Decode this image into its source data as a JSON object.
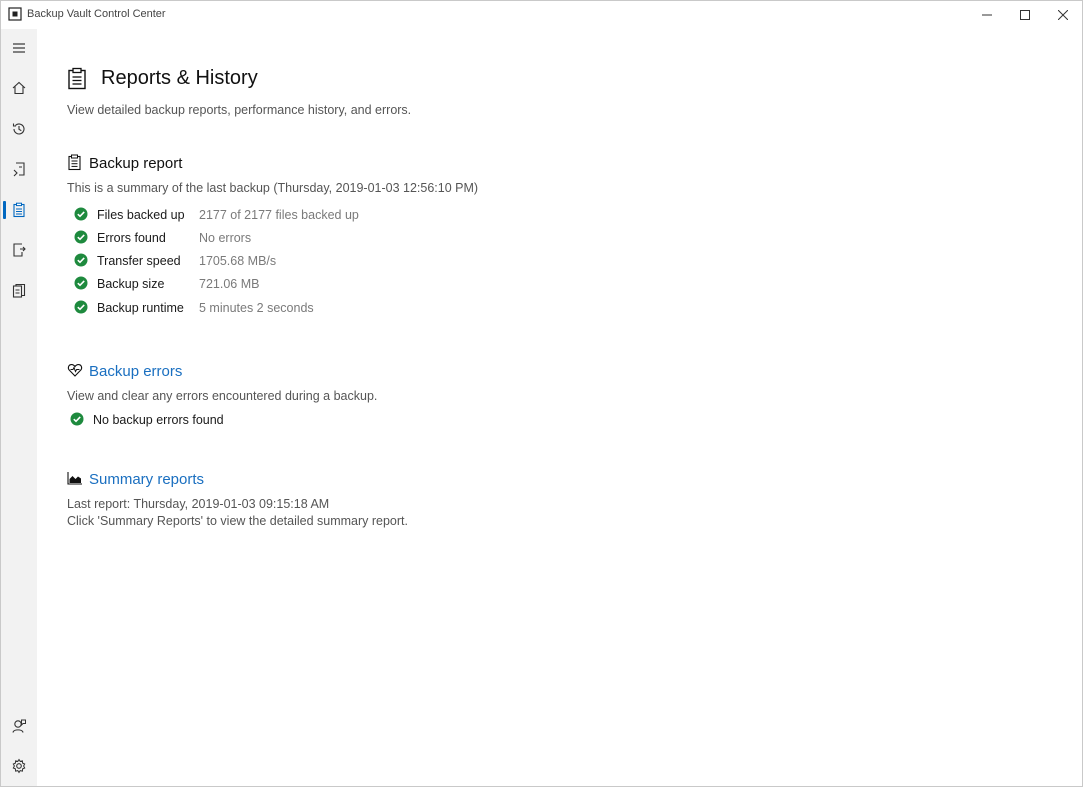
{
  "window": {
    "title": "Backup Vault Control Center"
  },
  "sidebar": {
    "items": [
      {
        "id": "menu",
        "icon": "hamburger-menu-icon"
      },
      {
        "id": "home",
        "icon": "home-icon"
      },
      {
        "id": "history",
        "icon": "history-icon"
      },
      {
        "id": "restore",
        "icon": "restore-icon"
      },
      {
        "id": "reports",
        "icon": "clipboard-icon",
        "active": true
      },
      {
        "id": "export",
        "icon": "export-icon"
      },
      {
        "id": "library",
        "icon": "library-icon"
      },
      {
        "id": "support",
        "icon": "support-icon"
      },
      {
        "id": "settings",
        "icon": "gear-icon"
      }
    ]
  },
  "page": {
    "title": "Reports & History",
    "subtitle": "View detailed backup reports, performance history, and errors."
  },
  "backup_report": {
    "title": "Backup report",
    "summary": "This is a summary of the last backup (Thursday, 2019-01-03 12:56:10 PM)",
    "rows": [
      {
        "label": "Files backed up",
        "value": "2177 of 2177 files backed up"
      },
      {
        "label": "Errors found",
        "value": "No errors"
      },
      {
        "label": "Transfer speed",
        "value": "1705.68 MB/s"
      },
      {
        "label": "Backup size",
        "value": "721.06 MB"
      },
      {
        "label": "Backup runtime",
        "value": "5 minutes 2 seconds"
      }
    ]
  },
  "backup_errors": {
    "title": "Backup errors",
    "description": "View and clear any errors encountered during a backup.",
    "status": "No backup errors found"
  },
  "summary_reports": {
    "title": "Summary reports",
    "last_report": "Last report: Thursday, 2019-01-03 09:15:18 AM",
    "hint": "Click 'Summary Reports' to view the detailed summary report."
  },
  "colors": {
    "accent": "#0067c0",
    "link": "#1a6fc0",
    "success": "#1e8a3e",
    "sidebar_bg": "#f2f2f2"
  }
}
